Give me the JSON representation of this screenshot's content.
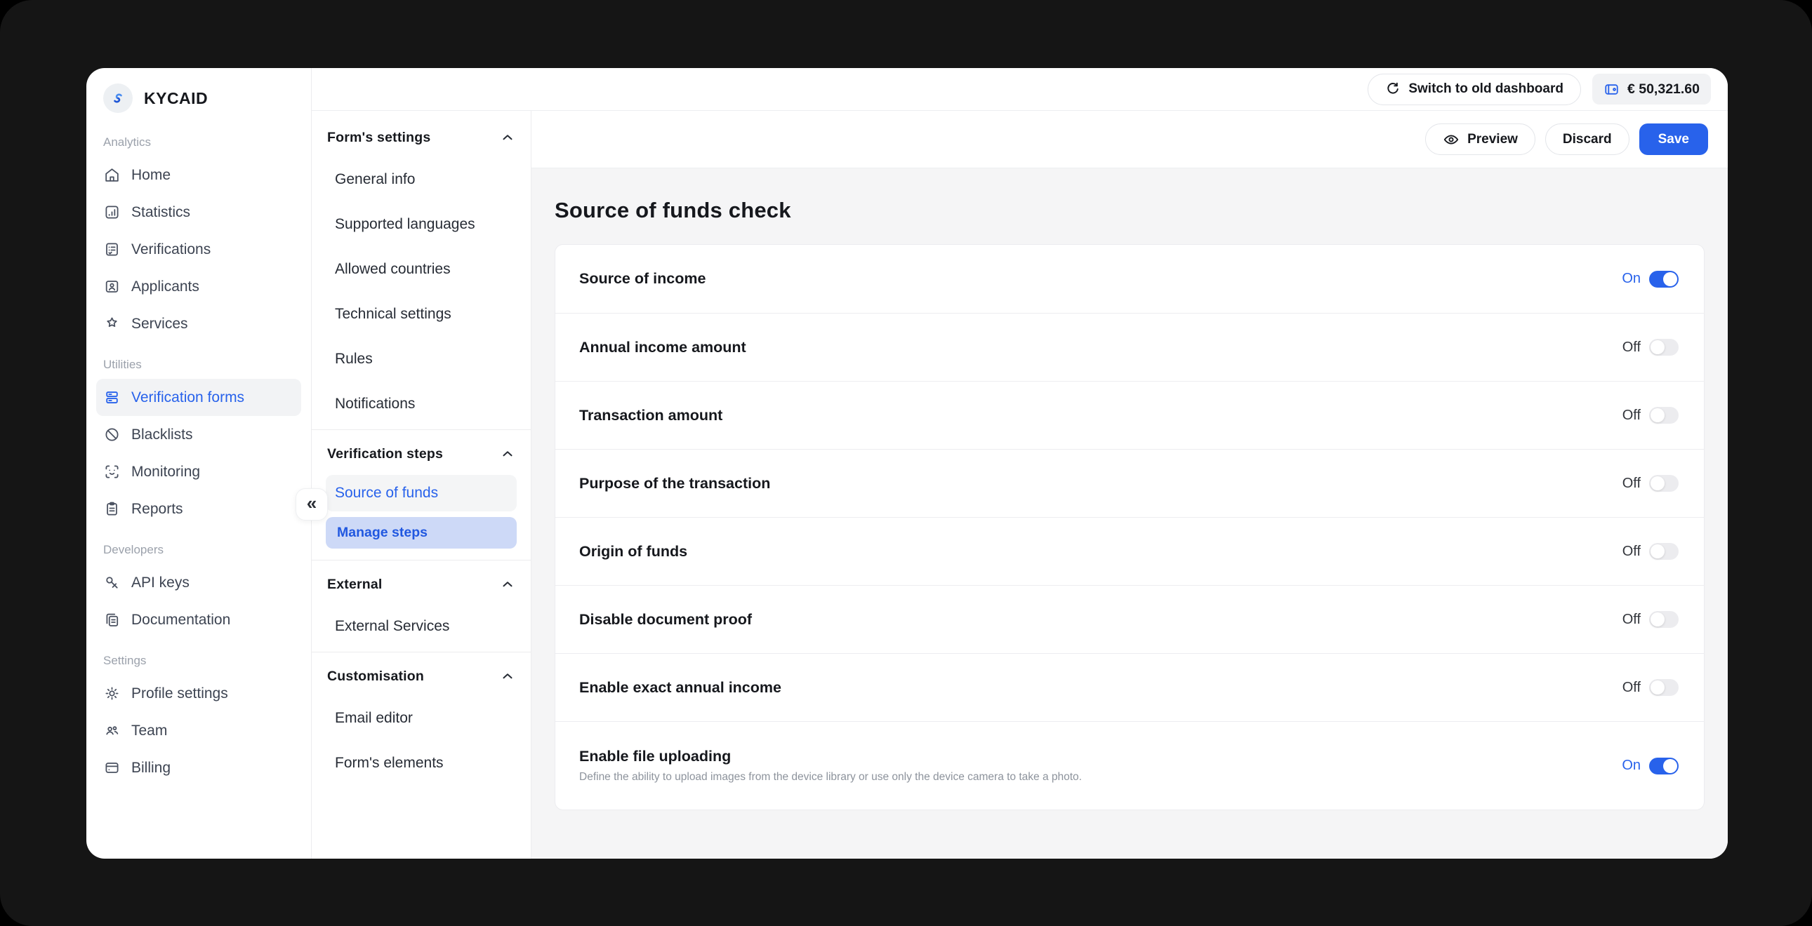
{
  "brand": {
    "name": "KYCAID",
    "logo_icon": "kycaid-swirl-icon"
  },
  "colors": {
    "accent": "#2862eb",
    "accent_soft_bg": "#cdd9f7",
    "selected_bg": "#f2f3f5",
    "content_bg": "#f5f5f6",
    "frame_bg": "#151515",
    "toggle_off": "#ececef"
  },
  "sidebar": {
    "sections": [
      {
        "label": "Analytics",
        "items": [
          {
            "label": "Home",
            "icon": "home-icon"
          },
          {
            "label": "Statistics",
            "icon": "statistics-icon"
          },
          {
            "label": "Verifications",
            "icon": "verifications-icon"
          },
          {
            "label": "Applicants",
            "icon": "applicants-icon"
          },
          {
            "label": "Services",
            "icon": "services-icon"
          }
        ]
      },
      {
        "label": "Utilities",
        "items": [
          {
            "label": "Verification forms",
            "icon": "verification-forms-icon",
            "active": true
          },
          {
            "label": "Blacklists",
            "icon": "blacklists-icon"
          },
          {
            "label": "Monitoring",
            "icon": "monitoring-icon"
          },
          {
            "label": "Reports",
            "icon": "reports-icon"
          }
        ]
      },
      {
        "label": "Developers",
        "items": [
          {
            "label": "API keys",
            "icon": "api-keys-icon"
          },
          {
            "label": "Documentation",
            "icon": "documentation-icon"
          }
        ]
      },
      {
        "label": "Settings",
        "items": [
          {
            "label": "Profile settings",
            "icon": "profile-settings-icon"
          },
          {
            "label": "Team",
            "icon": "team-icon"
          },
          {
            "label": "Billing",
            "icon": "billing-icon"
          }
        ]
      }
    ],
    "collapse_icon": "«"
  },
  "subsidebar": {
    "groups": [
      {
        "title": "Form's settings",
        "items": [
          "General info",
          "Supported languages",
          "Allowed countries",
          "Technical settings",
          "Rules",
          "Notifications"
        ]
      },
      {
        "title": "Verification steps",
        "active_item": "Source of funds",
        "action": "Manage steps"
      },
      {
        "title": "External",
        "items": [
          "External Services"
        ]
      },
      {
        "title": "Customisation",
        "items": [
          "Email editor",
          "Form's elements"
        ]
      }
    ]
  },
  "topbar": {
    "switch_label": "Switch to old dashboard",
    "switch_icon": "refresh-icon",
    "balance": "€ 50,321.60",
    "balance_icon": "wallet-icon"
  },
  "actionbar": {
    "preview_label": "Preview",
    "preview_icon": "eye-icon",
    "discard_label": "Discard",
    "save_label": "Save"
  },
  "content": {
    "title": "Source of funds check",
    "settings": [
      {
        "label": "Source of income",
        "state": "On"
      },
      {
        "label": "Annual income amount",
        "state": "Off"
      },
      {
        "label": "Transaction amount",
        "state": "Off"
      },
      {
        "label": "Purpose of the transaction",
        "state": "Off"
      },
      {
        "label": "Origin of funds",
        "state": "Off"
      },
      {
        "label": "Disable document proof",
        "state": "Off"
      },
      {
        "label": "Enable exact annual income",
        "state": "Off"
      },
      {
        "label": "Enable file uploading",
        "state": "On",
        "description": "Define the ability to upload images from the device library or use only the device camera to take a photo."
      }
    ]
  }
}
